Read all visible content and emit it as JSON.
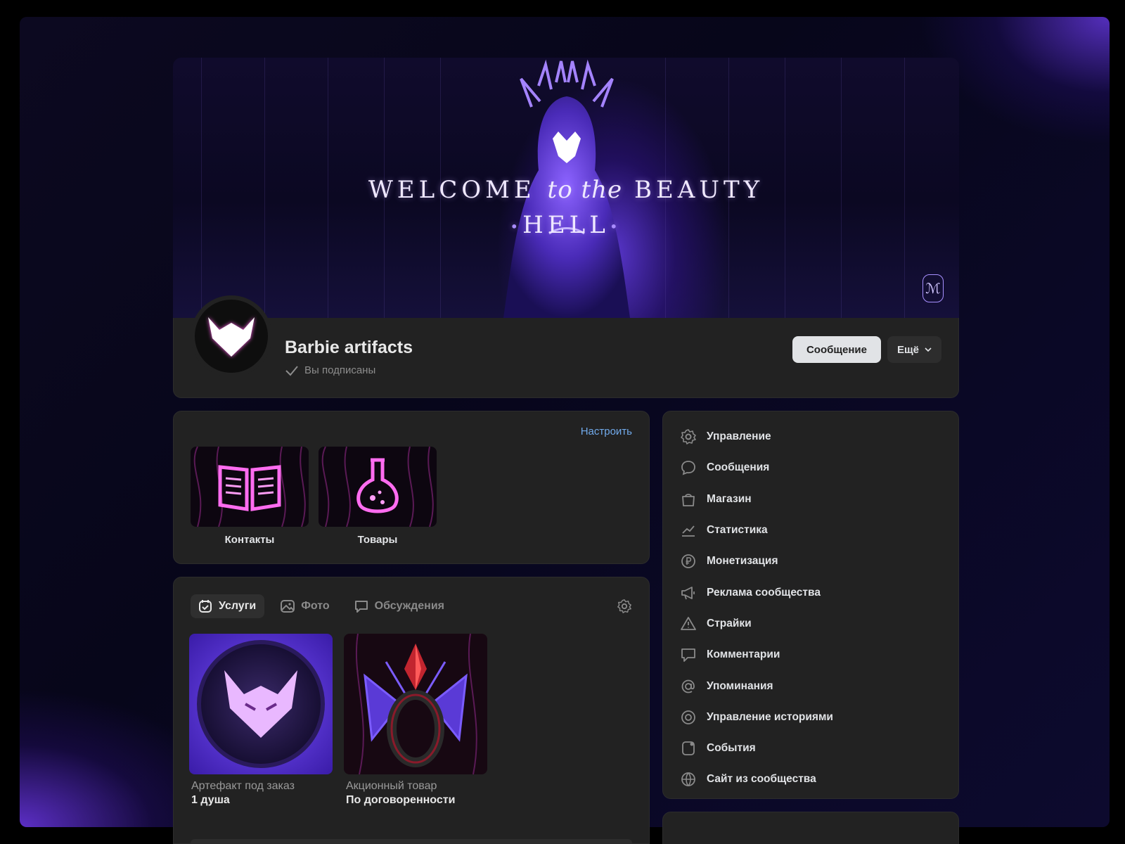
{
  "cover": {
    "title_a": "WELCOME",
    "title_b": "to the",
    "title_c": "BEAUTY",
    "subtitle": "HELL"
  },
  "group": {
    "name": "Barbie artifacts",
    "subscribed": "Вы подписаны"
  },
  "actions": {
    "message": "Сообщение",
    "more": "Ещё"
  },
  "apps": {
    "configure": "Настроить",
    "items": [
      {
        "label": "Контакты",
        "icon": "book-icon"
      },
      {
        "label": "Товары",
        "icon": "flask-icon"
      }
    ]
  },
  "tabs": [
    {
      "label": "Услуги",
      "icon": "calendar-check-icon",
      "active": true
    },
    {
      "label": "Фото",
      "icon": "photo-icon",
      "active": false
    },
    {
      "label": "Обсуждения",
      "icon": "chat-icon",
      "active": false
    }
  ],
  "products": [
    {
      "title": "Артефакт под заказ",
      "price": "1 душа"
    },
    {
      "title": "Акционный товар",
      "price": "По договоренности"
    }
  ],
  "menu": [
    {
      "label": "Управление",
      "icon": "gear-icon"
    },
    {
      "label": "Сообщения",
      "icon": "message-icon"
    },
    {
      "label": "Магазин",
      "icon": "shopping-bag-icon"
    },
    {
      "label": "Статистика",
      "icon": "chart-icon"
    },
    {
      "label": "Монетизация",
      "icon": "ruble-icon"
    },
    {
      "label": "Реклама сообщества",
      "icon": "megaphone-icon"
    },
    {
      "label": "Страйки",
      "icon": "warning-icon"
    },
    {
      "label": "Комментарии",
      "icon": "comment-icon"
    },
    {
      "label": "Упоминания",
      "icon": "at-icon"
    },
    {
      "label": "Управление историями",
      "icon": "stories-icon"
    },
    {
      "label": "События",
      "icon": "event-icon"
    },
    {
      "label": "Сайт из сообщества",
      "icon": "globe-icon"
    }
  ],
  "colors": {
    "accent": "#71aaeb",
    "card": "#222222",
    "neon": "#ff4fd8",
    "purple": "#7b4dff"
  }
}
